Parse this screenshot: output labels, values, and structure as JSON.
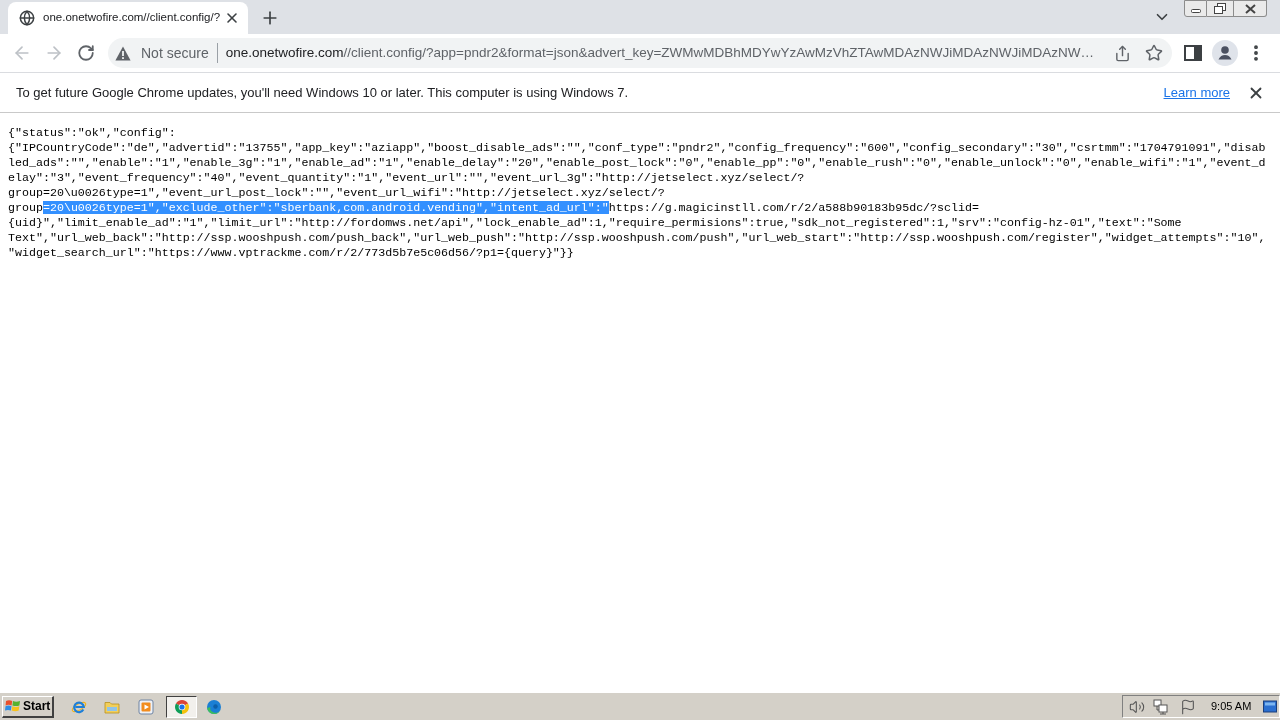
{
  "browser": {
    "tabs": [
      {
        "title": "one.onetwofire.com//client.config/?",
        "selected": true
      }
    ],
    "navigation": {
      "back": {
        "disabled": true
      },
      "forward": {
        "disabled": true
      }
    },
    "address_bar": {
      "security_label": "Not secure",
      "url_host": "one.onetwofire.com",
      "url_path": "//client.config/?app=pndr2&format=json&advert_key=ZWMwMDBhMDYwYzAwMzVhZTAwMDAzNWJiMDAzNWJiMDAzNW…"
    }
  },
  "infobar": {
    "message": "To get future Google Chrome updates, you'll need Windows 10 or later. This computer is using Windows 7.",
    "link": "Learn more"
  },
  "page": {
    "lines": [
      {
        "segments": [
          {
            "text": "{\"status\":\"ok\",\"config\":",
            "selected": false
          }
        ]
      },
      {
        "segments": [
          {
            "text": "{\"IPCountryCode\":\"de\",\"advertid\":\"13755\",\"app_key\":\"aziapp\",\"boost_disable_ads\":\"\",\"conf_type\":\"pndr2\",\"config_frequency\":\"600\",\"config_secondary\":\"30\",\"csrtmm\":\"1704791091\",\"disab",
            "selected": false
          }
        ]
      },
      {
        "segments": [
          {
            "text": "led_ads\":\"\",\"enable\":\"1\",\"enable_3g\":\"1\",\"enable_ad\":\"1\",\"enable_delay\":\"20\",\"enable_post_lock\":\"0\",\"enable_pp\":\"0\",\"enable_rush\":\"0\",\"enable_unlock\":\"0\",\"enable_wifi\":\"1\",\"event_d",
            "selected": false
          }
        ]
      },
      {
        "segments": [
          {
            "text": "elay\":\"3\",\"event_frequency\":\"40\",\"event_quantity\":\"1\",\"event_url\":\"\",\"event_url_3g\":\"http://jetselect.xyz/select/?",
            "selected": false
          }
        ]
      },
      {
        "segments": [
          {
            "text": "group=20\\u0026type=1\",\"event_url_post_lock\":\"\",\"event_url_wifi\":\"http://jetselect.xyz/select/?",
            "selected": false
          }
        ]
      },
      {
        "segments": [
          {
            "text": "group",
            "selected": false
          },
          {
            "text": "=20\\u0026type=1\",\"exclude_other\":\"sberbank,com.android.vending\",\"intent_ad_url\":\"",
            "selected": true
          },
          {
            "text": "https://g.magicinstll.com/r/2/a588b90183b95dc/?sclid=",
            "selected": false
          }
        ]
      },
      {
        "segments": [
          {
            "text": "{uid}\",\"limit_enable_ad\":\"1\",\"limit_url\":\"http://fordomws.net/api\",\"lock_enable_ad\":1,\"require_permisions\":true,\"sdk_not_registered\":1,\"srv\":\"config-hz-01\",\"text\":\"Some",
            "selected": false
          }
        ]
      },
      {
        "segments": [
          {
            "text": "Text\",\"url_web_back\":\"http://ssp.wooshpush.com/push_back\",\"url_web_push\":\"http://ssp.wooshpush.com/push\",\"url_web_start\":\"http://ssp.wooshpush.com/register\",\"widget_attempts\":\"10\",",
            "selected": false
          }
        ]
      },
      {
        "segments": [
          {
            "text": "\"widget_search_url\":\"https://www.vptrackme.com/r/2/773d5b7e5c06d56/?p1={query}\"}}",
            "selected": false
          }
        ]
      }
    ]
  },
  "taskbar": {
    "start": "Start",
    "apps": [
      {
        "kind": "ie",
        "selected": false
      },
      {
        "kind": "folder",
        "selected": false
      },
      {
        "kind": "player",
        "selected": false
      },
      {
        "kind": "chrome",
        "selected": true
      },
      {
        "kind": "edge",
        "selected": false
      }
    ],
    "clock": "9:05 AM"
  }
}
